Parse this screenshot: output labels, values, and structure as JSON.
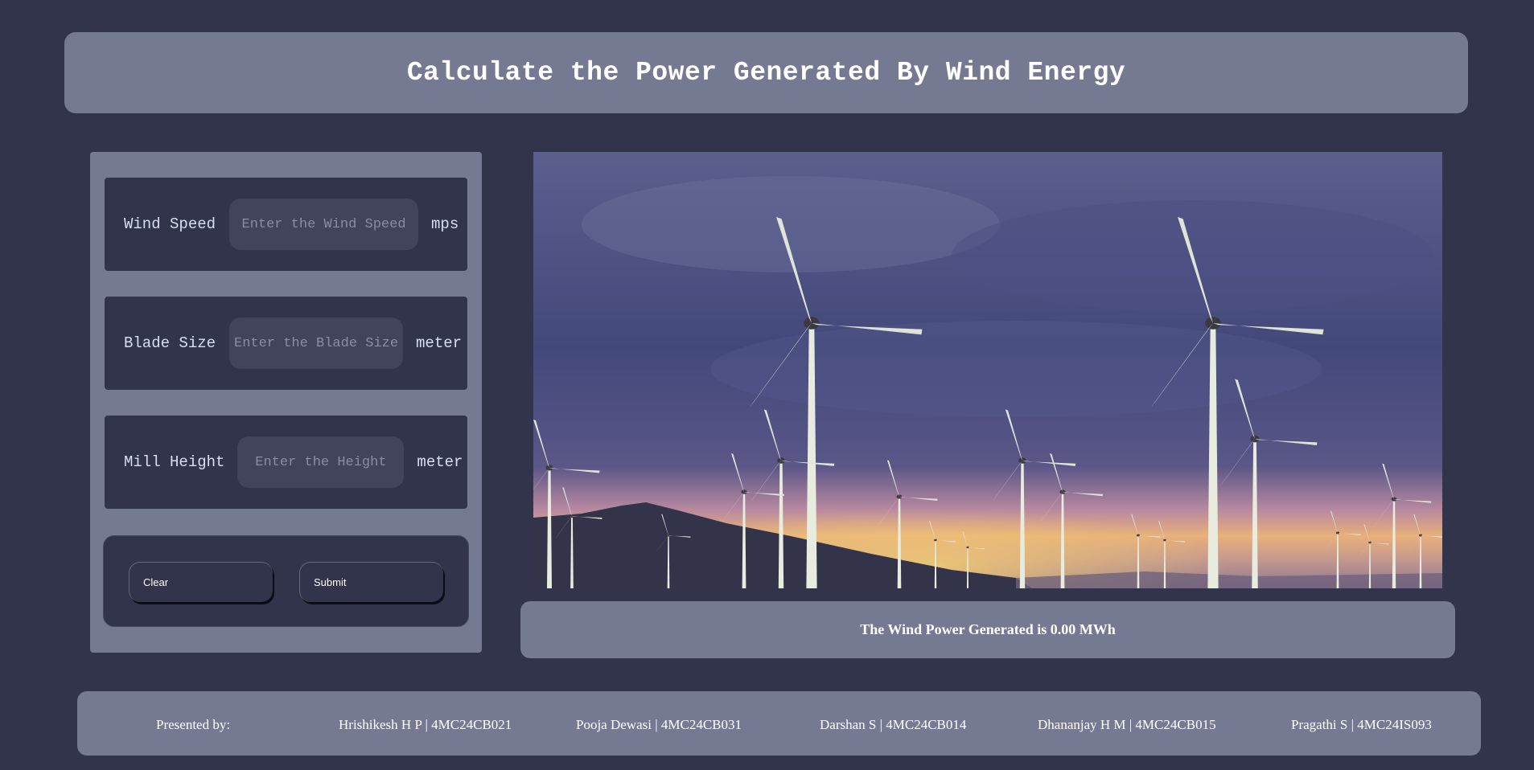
{
  "header": {
    "title": "Calculate the Power Generated By Wind Energy"
  },
  "form": {
    "wind_speed": {
      "label": "Wind Speed",
      "placeholder": "Enter the Wind Speed",
      "value": "",
      "unit": "mps"
    },
    "blade_size": {
      "label": "Blade Size",
      "placeholder": "Enter the Blade Size",
      "value": "",
      "unit": "meter"
    },
    "mill_height": {
      "label": "Mill Height",
      "placeholder": "Enter the Height",
      "value": "",
      "unit": "meter"
    },
    "clear_label": "Clear",
    "submit_label": "Submit"
  },
  "image": {
    "alt": "wind turbines"
  },
  "result": {
    "text": "The Wind Power Generated is 0.00 MWh"
  },
  "footer": {
    "presented_by": "Presented by:",
    "members": [
      "Hrishikesh H P | 4MC24CB021",
      "Pooja Dewasi | 4MC24CB031",
      "Darshan S | 4MC24CB014",
      "Dhananjay H M | 4MC24CB015",
      "Pragathi S | 4MC24IS093"
    ]
  },
  "colors": {
    "background": "#31344a",
    "panel": "#767992",
    "field_bg": "#31344a",
    "input_bg": "#41445a",
    "text": "#ffffff"
  }
}
